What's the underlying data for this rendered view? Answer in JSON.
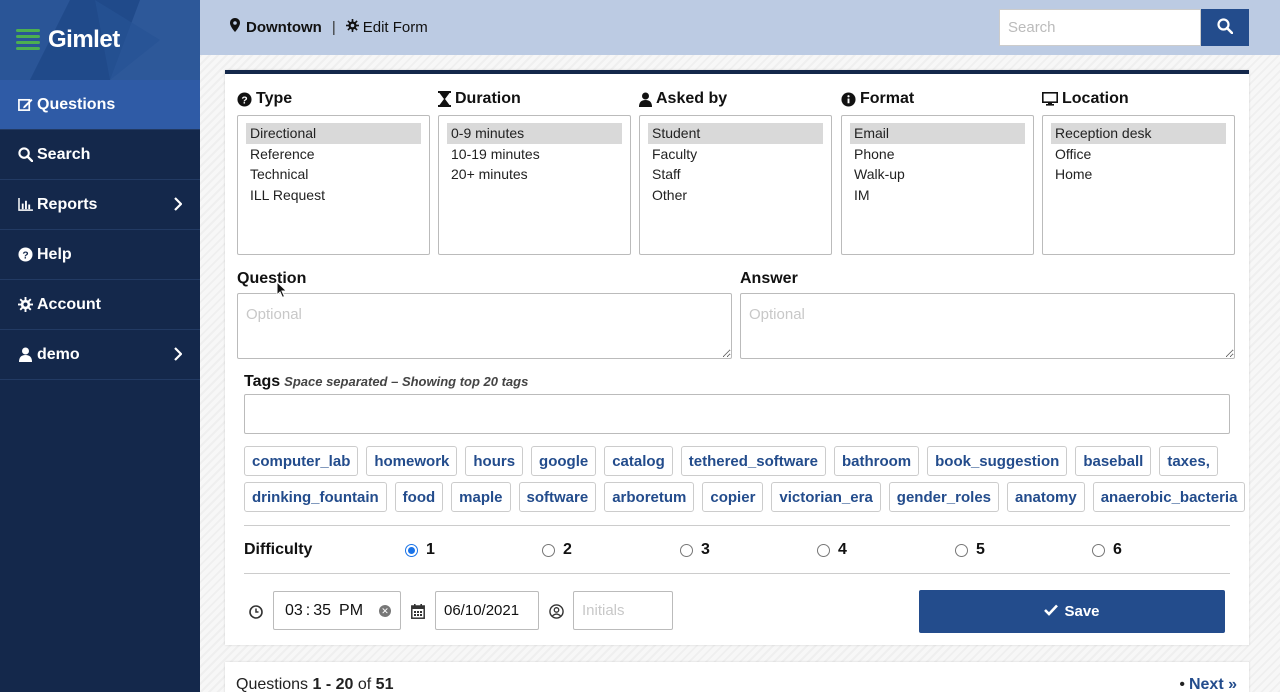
{
  "app": {
    "name": "Gimlet"
  },
  "colors": {
    "nav_bg": "#14284b",
    "accent": "#234c8c",
    "topbar": "#bccbe3",
    "active_nav": "#2f5ba6"
  },
  "sidebar": {
    "items": [
      {
        "label": "Questions",
        "icon": "edit-icon",
        "active": true
      },
      {
        "label": "Search",
        "icon": "search-icon"
      },
      {
        "label": "Reports",
        "icon": "bar-chart-icon",
        "has_submenu": true
      },
      {
        "label": "Help",
        "icon": "question-circle-icon"
      },
      {
        "label": "Account",
        "icon": "gear-icon"
      },
      {
        "label": "demo",
        "icon": "user-icon",
        "has_submenu": true
      }
    ]
  },
  "topbar": {
    "location": "Downtown",
    "edit_form": "Edit Form",
    "search_placeholder": "Search"
  },
  "form": {
    "columns": [
      {
        "title": "Type",
        "icon": "question-circle-icon",
        "options": [
          "Directional",
          "Reference",
          "Technical",
          "ILL Request"
        ],
        "selected": 0
      },
      {
        "title": "Duration",
        "icon": "hourglass-icon",
        "options": [
          "0-9 minutes",
          "10-19 minutes",
          "20+ minutes"
        ],
        "selected": 0
      },
      {
        "title": "Asked by",
        "icon": "user-icon",
        "options": [
          "Student",
          "Faculty",
          "Staff",
          "Other"
        ],
        "selected": 0
      },
      {
        "title": "Format",
        "icon": "info-circle-icon",
        "options": [
          "Email",
          "Phone",
          "Walk-up",
          "IM"
        ],
        "selected": 0
      },
      {
        "title": "Location",
        "icon": "monitor-icon",
        "options": [
          "Reception desk",
          "Office",
          "Home"
        ],
        "selected": 0
      }
    ],
    "question": {
      "label": "Question",
      "placeholder": "Optional"
    },
    "answer": {
      "label": "Answer",
      "placeholder": "Optional"
    },
    "tags": {
      "label": "Tags",
      "note": "Space separated – Showing top 20 tags",
      "value": "",
      "row1": [
        "computer_lab",
        "homework",
        "hours",
        "google",
        "catalog",
        "tethered_software",
        "bathroom",
        "book_suggestion",
        "baseball",
        "taxes,"
      ],
      "row2": [
        "drinking_fountain",
        "food",
        "maple",
        "software",
        "arboretum",
        "copier",
        "victorian_era",
        "gender_roles",
        "anatomy",
        "anaerobic_bacteria"
      ]
    },
    "difficulty": {
      "label": "Difficulty",
      "options": [
        "1",
        "2",
        "3",
        "4",
        "5",
        "6"
      ],
      "selected": 0
    },
    "time": {
      "hour": "03",
      "sep": ":",
      "minute": "35",
      "ampm": "PM"
    },
    "date": "06/10/2021",
    "initials_placeholder": "Initials",
    "save_label": "Save"
  },
  "results": {
    "prefix": "Questions",
    "range": "1 - 20",
    "of": "of",
    "total": "51",
    "next_label": "Next »",
    "dot": "•"
  }
}
